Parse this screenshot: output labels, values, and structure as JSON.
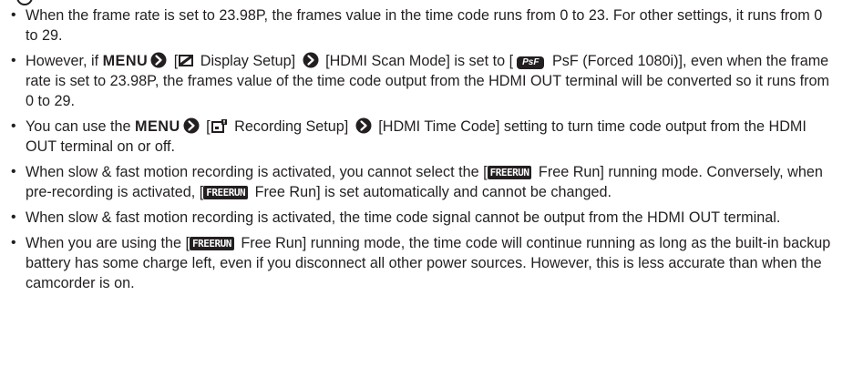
{
  "glyphs": {
    "bullet": "•",
    "menu": "MENU",
    "psf": "PsF",
    "freerun": "FREERUN"
  },
  "notes": {
    "n1": {
      "text": "When the frame rate is set to 23.98P, the frames value in the time code runs from 0 to 23. For other settings, it runs from 0 to 29."
    },
    "n2": {
      "a": "However, if ",
      "b": " [",
      "c": " Display Setup] ",
      "d": " [HDMI Scan Mode] is set to [",
      "e": " PsF (Forced 1080i)], even when the frame rate is set to 23.98P, the frames value of the time code output from the HDMI OUT terminal will be converted so it runs from 0 to 29."
    },
    "n3": {
      "a": "You can use the ",
      "b": " [",
      "c": " Recording Setup] ",
      "d": " [HDMI Time Code] setting to turn time code output from the HDMI OUT terminal on or off."
    },
    "n4": {
      "a": "When slow & fast motion recording is activated, you cannot select the [",
      "b": " Free Run] running mode. Conversely, when pre-recording is activated, [",
      "c": " Free Run] is set automatically and cannot be changed."
    },
    "n5": {
      "text": "When slow & fast motion recording is activated, the time code signal cannot be output from the HDMI OUT terminal."
    },
    "n6": {
      "a": "When you are using the [",
      "b": " Free Run] running mode, the time code will continue running as long as the built-in backup battery has some charge left, even if you disconnect all other power sources. However, this is less accurate than when the camcorder is on."
    }
  }
}
